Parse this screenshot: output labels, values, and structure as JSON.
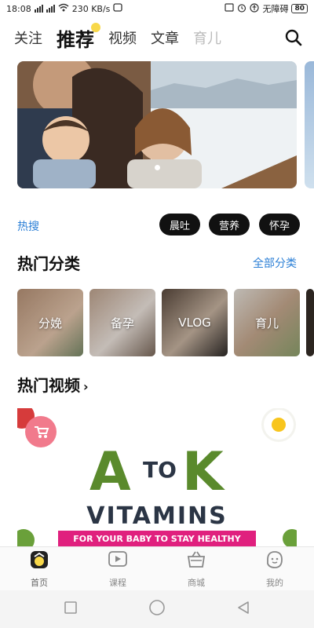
{
  "status_bar": {
    "time": "18:08",
    "network_speed": "230 KB/s",
    "accessibility_text": "无障碍",
    "battery": "80"
  },
  "top_tabs": [
    {
      "label": "关注",
      "state": "normal"
    },
    {
      "label": "推荐",
      "state": "active"
    },
    {
      "label": "视频",
      "state": "normal"
    },
    {
      "label": "文章",
      "state": "normal"
    },
    {
      "label": "育儿",
      "state": "faded"
    }
  ],
  "hot_search": {
    "label": "热搜",
    "chips": [
      "晨吐",
      "营养",
      "怀孕"
    ]
  },
  "categories_section": {
    "title": "热门分类",
    "see_all": "全部分类",
    "items": [
      "分娩",
      "备孕",
      "VLOG",
      "育儿"
    ]
  },
  "videos_section": {
    "title": "热门视频",
    "chevron": "›",
    "card": {
      "letter_a": "A",
      "to": "TO",
      "letter_k": "K",
      "headline": "VITAMINS",
      "tagline": "FOR YOUR BABY TO STAY HEALTHY"
    }
  },
  "bottom_nav": [
    {
      "label": "首页",
      "icon": "home-icon",
      "active": true
    },
    {
      "label": "课程",
      "icon": "play-icon",
      "active": false
    },
    {
      "label": "商城",
      "icon": "basket-icon",
      "active": false
    },
    {
      "label": "我的",
      "icon": "profile-icon",
      "active": false
    }
  ],
  "colors": {
    "accent_blue": "#2b7fd6",
    "chip_bg": "#111111",
    "tab_dot": "#f8d84a",
    "badge_pink": "#f17a8c",
    "tagline_pink": "#e0207e"
  }
}
